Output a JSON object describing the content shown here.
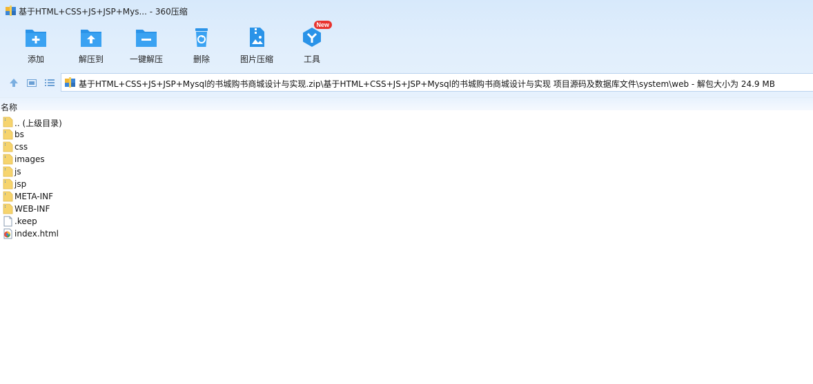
{
  "window": {
    "title": "基于HTML+CSS+JS+JSP+Mys... - 360压缩"
  },
  "toolbar": {
    "items": [
      {
        "label": "添加",
        "icon": "add-folder-icon"
      },
      {
        "label": "解压到",
        "icon": "extract-to-icon"
      },
      {
        "label": "一键解压",
        "icon": "one-click-extract-icon"
      },
      {
        "label": "删除",
        "icon": "trash-icon"
      },
      {
        "label": "图片压缩",
        "icon": "image-compress-icon"
      },
      {
        "label": "工具",
        "icon": "tools-icon",
        "badge": "New"
      }
    ]
  },
  "nav": {
    "path": "基于HTML+CSS+JS+JSP+Mysql的书城购书商城设计与实现.zip\\基于HTML+CSS+JS+JSP+Mysql的书城购书商城设计与实现 项目源码及数据库文件\\system\\web - 解包大小为 24.9 MB"
  },
  "list": {
    "column_name": "名称",
    "items": [
      {
        "name": ".. (上级目录)",
        "type": "folder"
      },
      {
        "name": "bs",
        "type": "folder"
      },
      {
        "name": "css",
        "type": "folder"
      },
      {
        "name": "images",
        "type": "folder"
      },
      {
        "name": "js",
        "type": "folder"
      },
      {
        "name": "jsp",
        "type": "folder"
      },
      {
        "name": "META-INF",
        "type": "folder"
      },
      {
        "name": "WEB-INF",
        "type": "folder"
      },
      {
        "name": ".keep",
        "type": "file"
      },
      {
        "name": "index.html",
        "type": "html"
      }
    ]
  },
  "colors": {
    "accent": "#2a93e8",
    "chrome_bg": "#dcebfb",
    "folder": "#f6d46e",
    "badge": "#e8332e"
  }
}
